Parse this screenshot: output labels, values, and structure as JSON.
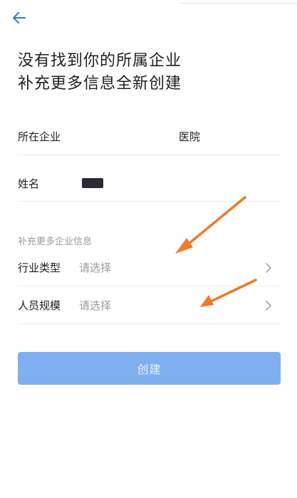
{
  "header": {
    "back_icon": "arrow-left-icon",
    "title_line1": "没有找到你的所属企业",
    "title_line2": "补充更多信息全新创建"
  },
  "form": {
    "company": {
      "label": "所在企业",
      "value": "医院"
    },
    "name": {
      "label": "姓名",
      "value_masked": true
    },
    "section_title": "补充更多企业信息",
    "industry": {
      "label": "行业类型",
      "placeholder": "请选择",
      "icon": "chevron-right-icon"
    },
    "staff_size": {
      "label": "人员规模",
      "placeholder": "请选择",
      "icon": "chevron-right-icon"
    }
  },
  "actions": {
    "create_label": "创建"
  },
  "colors": {
    "accent": "#3a73c9",
    "button_bg": "#80afef",
    "button_text": "#e9f1fc",
    "annotation_arrow": "#f07a2a",
    "placeholder": "#9a9a9a",
    "divider": "#ececec"
  }
}
